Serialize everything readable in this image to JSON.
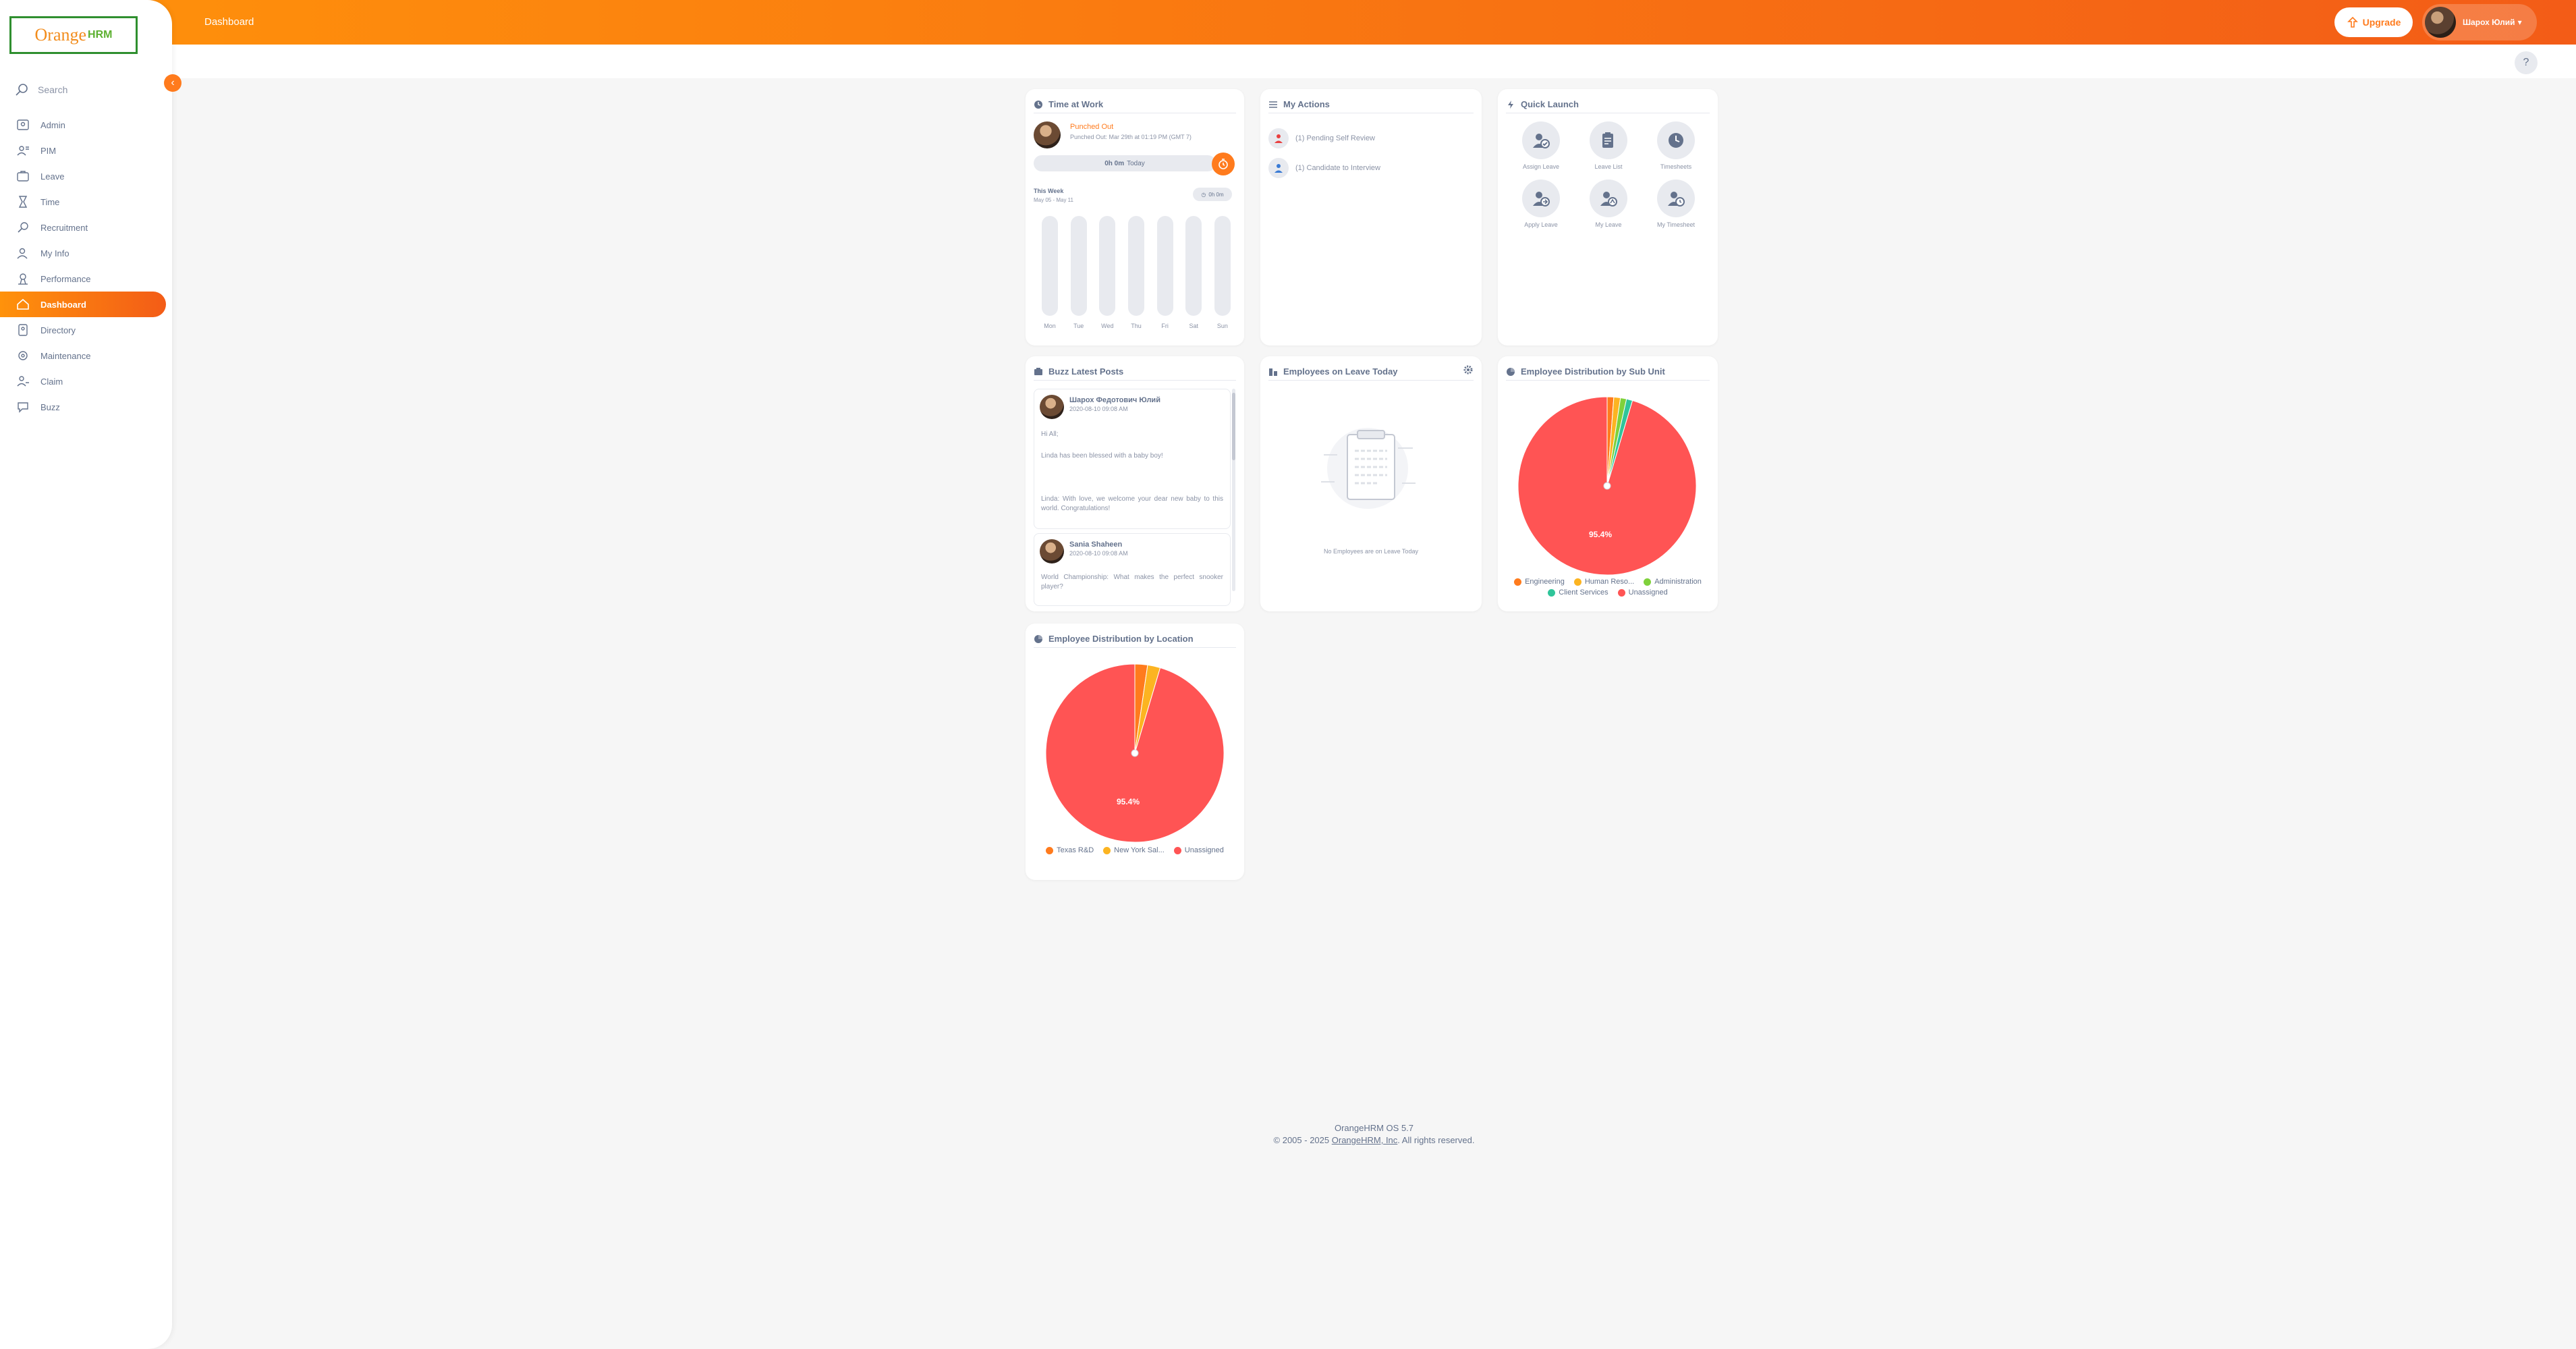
{
  "brand": {
    "name_orange": "Orange",
    "name_hrm": "HRM"
  },
  "sidebar": {
    "search_placeholder": "Search",
    "items": [
      {
        "label": "Admin",
        "icon": "admin-icon"
      },
      {
        "label": "PIM",
        "icon": "pim-icon"
      },
      {
        "label": "Leave",
        "icon": "leave-icon"
      },
      {
        "label": "Time",
        "icon": "time-icon"
      },
      {
        "label": "Recruitment",
        "icon": "recruitment-icon"
      },
      {
        "label": "My Info",
        "icon": "my-info-icon"
      },
      {
        "label": "Performance",
        "icon": "performance-icon"
      },
      {
        "label": "Dashboard",
        "icon": "dashboard-icon",
        "active": true
      },
      {
        "label": "Directory",
        "icon": "directory-icon"
      },
      {
        "label": "Maintenance",
        "icon": "maintenance-icon"
      },
      {
        "label": "Claim",
        "icon": "claim-icon"
      },
      {
        "label": "Buzz",
        "icon": "buzz-icon"
      }
    ]
  },
  "topbar": {
    "breadcrumb": "Dashboard",
    "upgrade_label": "Upgrade",
    "user_name": "Шарох Юлий",
    "help_label": "?"
  },
  "time_at_work": {
    "title": "Time at Work",
    "status": "Punched Out",
    "since": "Punched Out: Mar 29th at 01:19 PM (GMT 7)",
    "today_hours": "0h 0m",
    "today_label": "Today",
    "week_label": "This Week",
    "week_range": "May 05 - May 11",
    "week_total": "0h 0m",
    "days": [
      "Mon",
      "Tue",
      "Wed",
      "Thu",
      "Fri",
      "Sat",
      "Sun"
    ]
  },
  "my_actions": {
    "title": "My Actions",
    "items": [
      "(1) Pending Self Review",
      "(1) Candidate to Interview"
    ]
  },
  "quick_launch": {
    "title": "Quick Launch",
    "items": [
      {
        "label": "Assign Leave",
        "icon": "assign-leave-icon"
      },
      {
        "label": "Leave List",
        "icon": "leave-list-icon"
      },
      {
        "label": "Timesheets",
        "icon": "timesheets-icon"
      },
      {
        "label": "Apply Leave",
        "icon": "apply-leave-icon"
      },
      {
        "label": "My Leave",
        "icon": "my-leave-icon"
      },
      {
        "label": "My Timesheet",
        "icon": "my-timesheet-icon"
      }
    ]
  },
  "buzz": {
    "title": "Buzz Latest Posts",
    "posts": [
      {
        "author": "Шарох Федотович Юлий",
        "date": "2020-08-10 09:08 AM",
        "text1": "Hi All;",
        "text2": "Linda has been blessed with a baby boy!",
        "text3": "Linda: With love, we welcome your dear new baby to this world. Congratulations!"
      },
      {
        "author": "Sania Shaheen",
        "date": "2020-08-10 09:08 AM",
        "text1": "World Championship: What makes the perfect snooker player?"
      }
    ]
  },
  "leave_today": {
    "title": "Employees on Leave Today",
    "empty_text": "No Employees are on Leave Today"
  },
  "colors": {
    "accent": "#ff7b1d",
    "engineering": "#ff7b1d",
    "human_resources": "#fcb421",
    "administration": "#7fd13b",
    "client_services": "#2fc59a",
    "unassigned": "#ff5454"
  },
  "chart_data": [
    {
      "type": "pie",
      "title": "Employee Distribution by Sub Unit",
      "labels": [
        "Engineering",
        "Human Reso...",
        "Administration",
        "Client Services",
        "Unassigned"
      ],
      "colors": [
        "#ff7b1d",
        "#fcb421",
        "#7fd13b",
        "#2fc59a",
        "#ff5454"
      ],
      "values": [
        1.2,
        1.2,
        1.1,
        1.1,
        95.4
      ],
      "center_label": "95.4%"
    },
    {
      "type": "pie",
      "title": "Employee Distribution by Location",
      "labels": [
        "Texas R&D",
        "New York Sal...",
        "Unassigned"
      ],
      "colors": [
        "#ff7b1d",
        "#fcb421",
        "#ff5454"
      ],
      "values": [
        2.3,
        2.3,
        95.4
      ],
      "center_label": "95.4%"
    }
  ],
  "footer": {
    "version": "OrangeHRM OS 5.7",
    "copyright_prefix": "© 2005 - 2025",
    "company": "OrangeHRM, Inc",
    "copyright_suffix": ". All rights reserved."
  }
}
